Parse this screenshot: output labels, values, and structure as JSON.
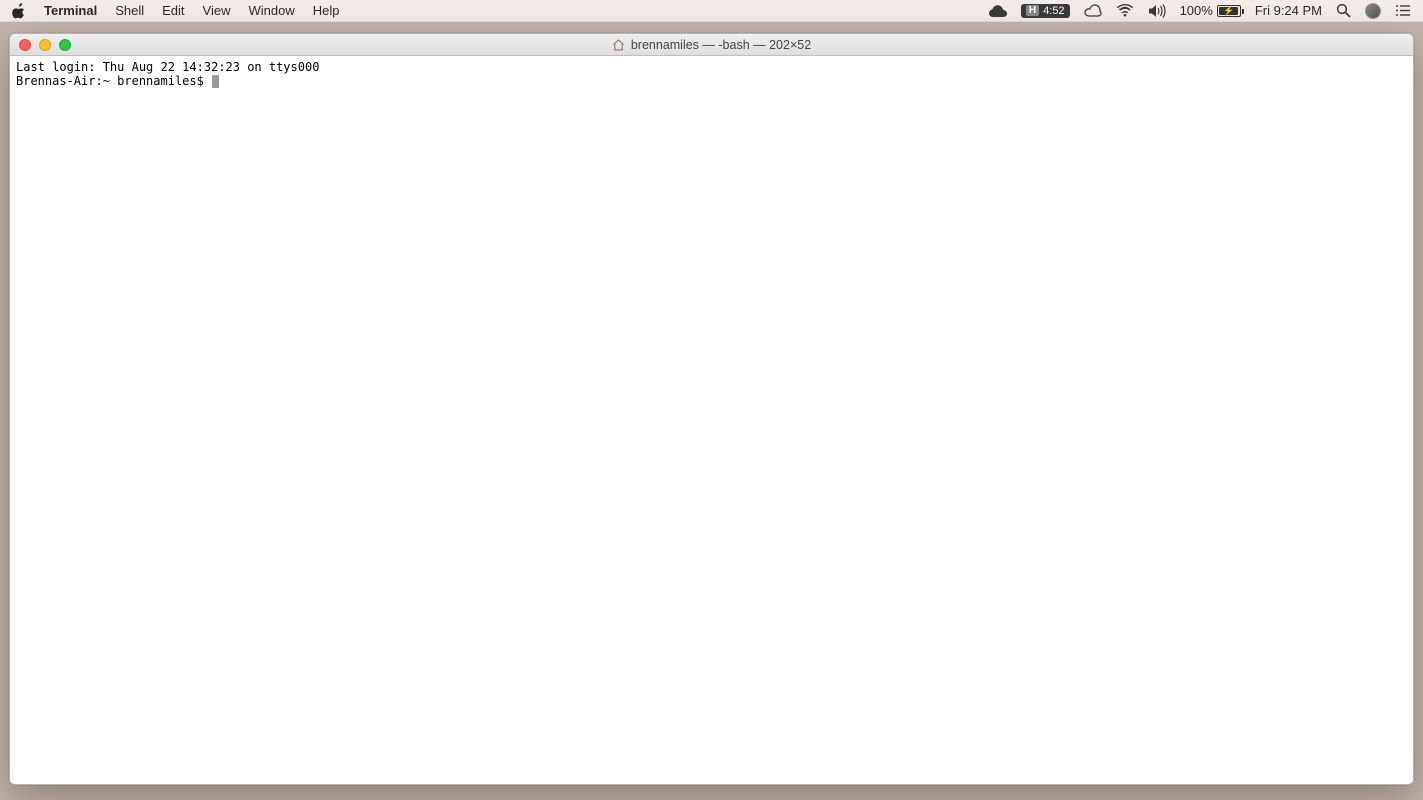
{
  "menubar": {
    "app_name": "Terminal",
    "items": [
      "Shell",
      "Edit",
      "View",
      "Window",
      "Help"
    ]
  },
  "status": {
    "timer": "4:52",
    "timer_prefix": "H",
    "battery_percent": "100%",
    "clock": "Fri 9:24 PM"
  },
  "window": {
    "title": "brennamiles — -bash — 202×52"
  },
  "terminal": {
    "last_login": "Last login: Thu Aug 22 14:32:23 on ttys000",
    "prompt": "Brennas-Air:~ brennamiles$ "
  }
}
